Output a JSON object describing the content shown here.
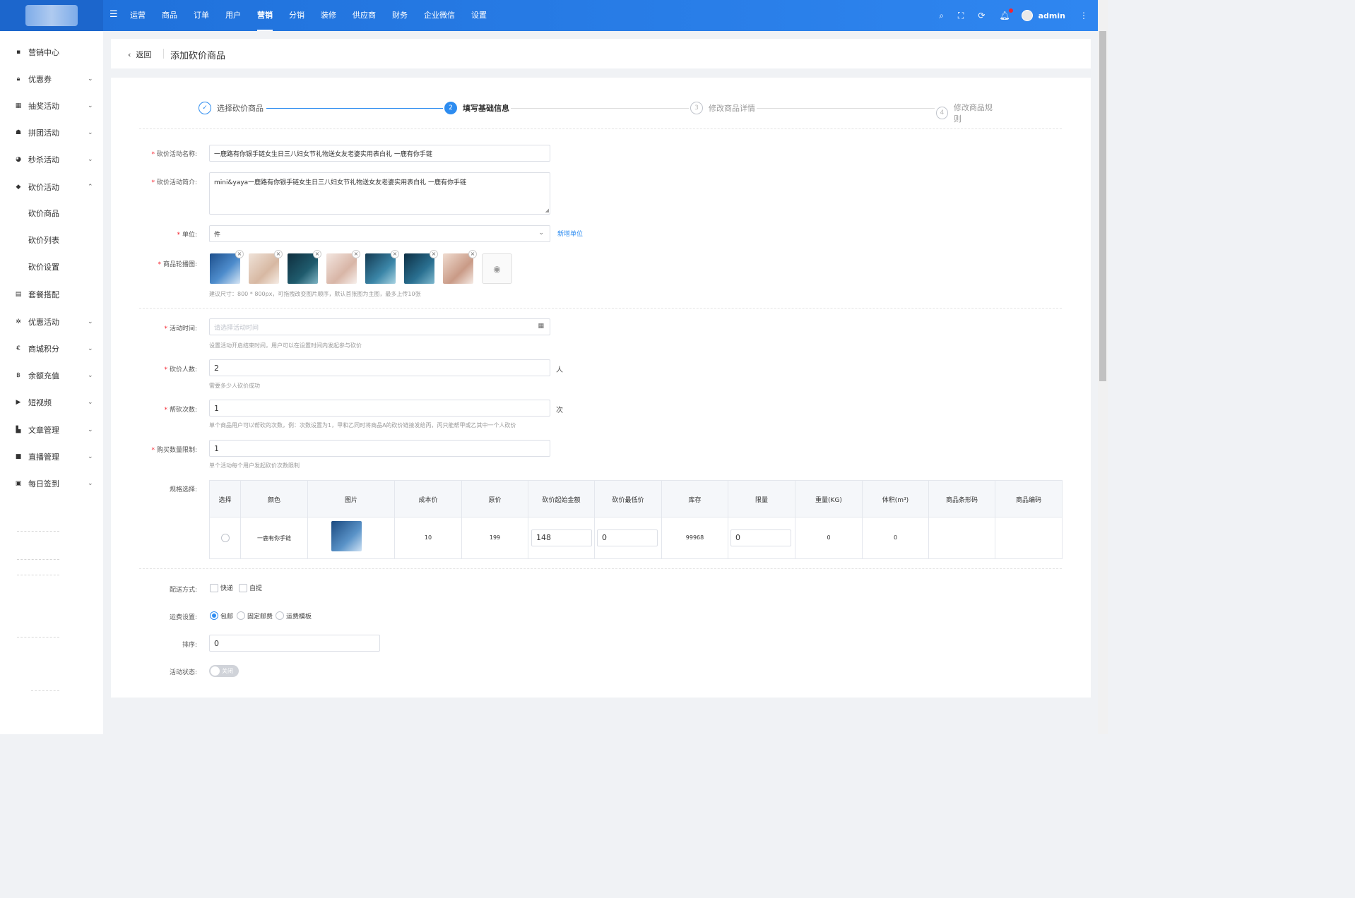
{
  "topbar": {
    "menu": [
      "运营",
      "商品",
      "订单",
      "用户",
      "营销",
      "分销",
      "装修",
      "供应商",
      "财务",
      "企业微信",
      "设置"
    ],
    "active": "营销",
    "username": "admin"
  },
  "sidebar": {
    "items": [
      {
        "label": "营销中心",
        "icon": "dashboard-icon",
        "chevron": ""
      },
      {
        "label": "优惠券",
        "icon": "lock-icon",
        "chevron": "⌄"
      },
      {
        "label": "抽奖活动",
        "icon": "grid-icon",
        "chevron": "⌄"
      },
      {
        "label": "拼团活动",
        "icon": "group-icon",
        "chevron": "⌄"
      },
      {
        "label": "秒杀活动",
        "icon": "clock-icon",
        "chevron": "⌄"
      },
      {
        "label": "砍价活动",
        "icon": "tag-icon",
        "chevron": "⌃"
      },
      {
        "label": "套餐搭配",
        "icon": "package-icon",
        "chevron": ""
      },
      {
        "label": "优惠活动",
        "icon": "discount-icon",
        "chevron": "⌄"
      },
      {
        "label": "商城积分",
        "icon": "points-icon",
        "chevron": "⌄"
      },
      {
        "label": "余额充值",
        "icon": "coin-icon",
        "chevron": "⌄"
      },
      {
        "label": "短视频",
        "icon": "video-icon",
        "chevron": "⌄"
      },
      {
        "label": "文章管理",
        "icon": "article-icon",
        "chevron": "⌄"
      },
      {
        "label": "直播管理",
        "icon": "camera-icon",
        "chevron": "⌄"
      },
      {
        "label": "每日签到",
        "icon": "calendar-icon",
        "chevron": "⌄"
      }
    ],
    "sub_items": [
      "砍价商品",
      "砍价列表",
      "砍价设置"
    ]
  },
  "header": {
    "back": "返回",
    "title": "添加砍价商品"
  },
  "steps": [
    {
      "num": "✓",
      "label": "选择砍价商品",
      "state": "done"
    },
    {
      "num": "2",
      "label": "填写基础信息",
      "state": "current"
    },
    {
      "num": "3",
      "label": "修改商品详情",
      "state": "todo"
    },
    {
      "num": "4",
      "label": "修改商品规则",
      "state": "todo"
    }
  ],
  "form": {
    "name_label": "砍价活动名称:",
    "name_value": "一鹿路有你银手链女生日三八妇女节礼物送女友老婆实用表白礼 一鹿有你手链",
    "intro_label": "砍价活动简介:",
    "intro_value": "mini&yaya一鹿路有你银手链女生日三八妇女节礼物送女友老婆实用表白礼 一鹿有你手链",
    "unit_label": "单位:",
    "unit_value": "件",
    "new_unit_link": "新增单位",
    "carousel_label": "商品轮播图:",
    "carousel_help": "建议尺寸：800 * 800px，可拖拽改变图片顺序，默认首张图为主图，最多上传10张",
    "time_label": "活动时间:",
    "time_placeholder": "请选择活动时间",
    "time_help": "设置活动开启结束时间，用户可以在设置时间内发起参与砍价",
    "people_label": "砍价人数:",
    "people_value": "2",
    "people_unit": "人",
    "people_help": "需要多少人砍价成功",
    "help_label": "帮砍次数:",
    "help_value": "1",
    "help_unit": "次",
    "help_help": "单个商品用户可以帮砍的次数，例：次数设置为1，甲和乙同时将商品A的砍价链接发给丙，丙只能帮甲或乙其中一个人砍价",
    "limit_label": "购买数量限制:",
    "limit_value": "1",
    "limit_help": "单个活动每个用户发起砍价次数限制",
    "spec_label": "规格选择:",
    "delivery_label": "配送方式:",
    "delivery_options": [
      "快递",
      "自提"
    ],
    "freight_label": "运费设置:",
    "freight_options": [
      "包邮",
      "固定邮费",
      "运费模板"
    ],
    "sort_label": "排序:",
    "sort_value": "0",
    "status_label": "活动状态:",
    "status_value": "关闭"
  },
  "spec_table": {
    "headers": [
      "选择",
      "颜色",
      "图片",
      "成本价",
      "原价",
      "砍价起始金额",
      "砍价最低价",
      "库存",
      "限量",
      "重量(KG)",
      "体积(m³)",
      "商品条形码",
      "商品编码"
    ],
    "row": {
      "color": "一鹿有你手链",
      "cost": "10",
      "price": "199",
      "start": "148",
      "min": "0",
      "stock": "99968",
      "limit": "0",
      "weight": "0",
      "volume": "0",
      "barcode": "",
      "code": ""
    }
  },
  "colors": {
    "brand": "#2d8cf0",
    "topbar": "#1e6fd9",
    "required": "#f5222d"
  }
}
